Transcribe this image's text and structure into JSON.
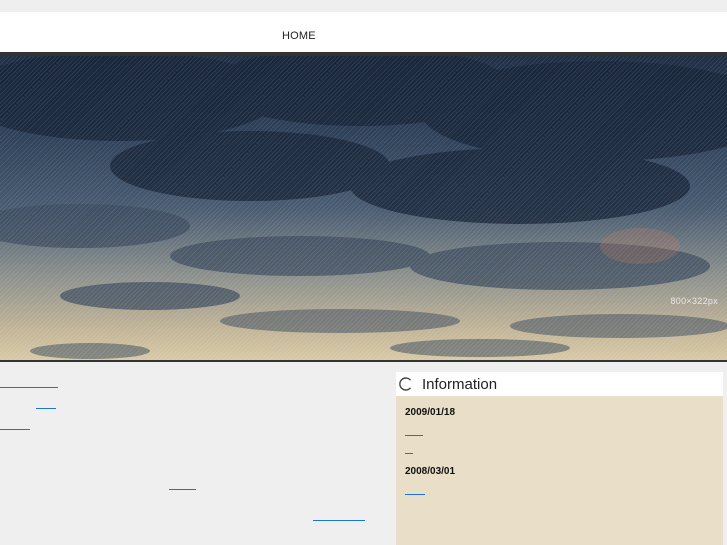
{
  "nav": {
    "home": "HOME"
  },
  "hero": {
    "dimension_label": "800×322px"
  },
  "info": {
    "title": "Information",
    "icon": "circle-arc-icon",
    "entries": [
      {
        "date": "2009/01/18"
      },
      {
        "date": "2008/03/01"
      }
    ]
  },
  "colors": {
    "link": "#1a73d9",
    "info_bg": "#e9dfc9",
    "page_bg": "#efefef"
  }
}
